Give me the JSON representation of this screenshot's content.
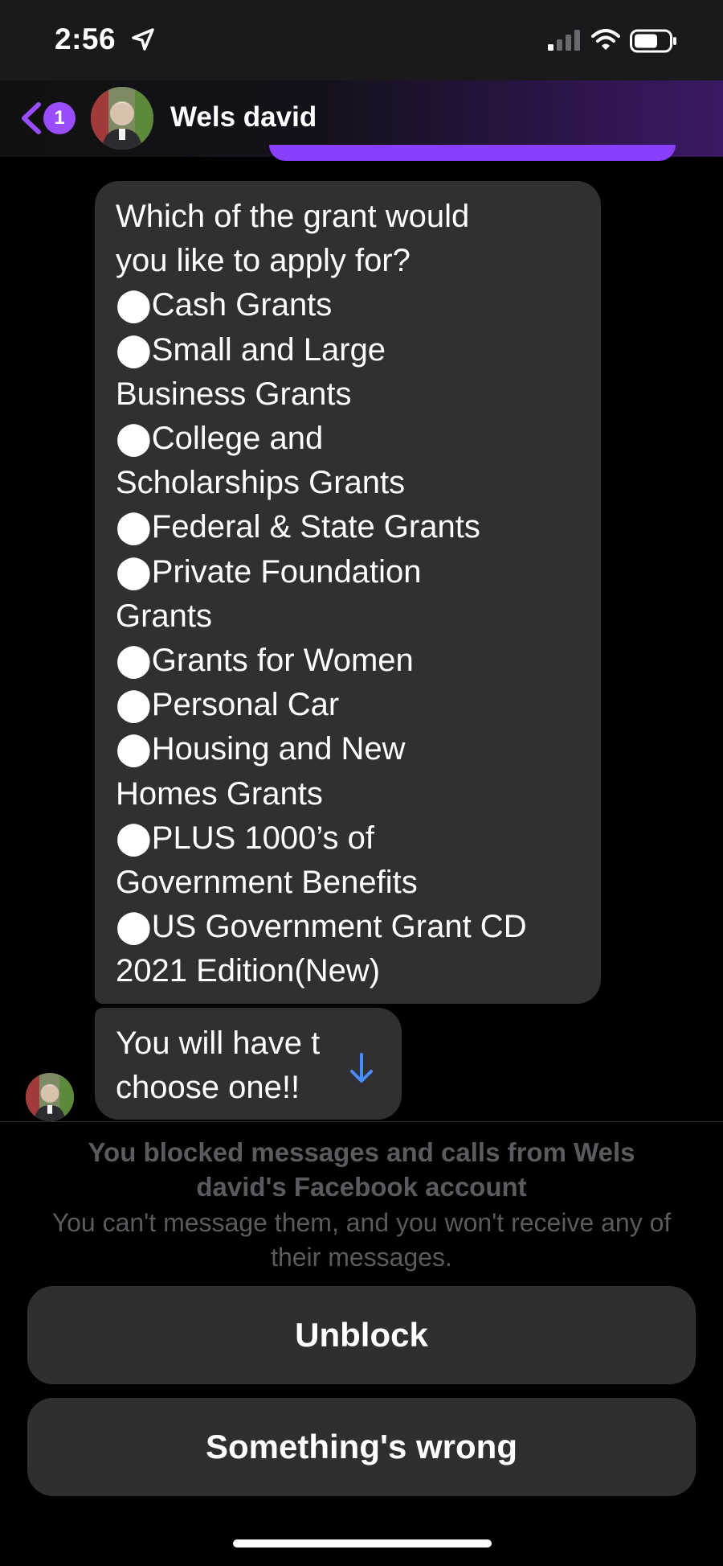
{
  "status_bar": {
    "time": "2:56",
    "icons": [
      "location-arrow-icon",
      "cellular-signal-icon",
      "wifi-icon",
      "battery-icon"
    ]
  },
  "header": {
    "back_badge_count": "1",
    "contact_name": "Wels david",
    "accent_color": "#9a4dff"
  },
  "messages": [
    {
      "sender": "Wels david",
      "lines": [
        "Which of the grant would",
        "you like to apply for?",
        "⬤Cash Grants",
        "⬤Small and Large",
        "Business Grants",
        "⬤College and",
        "Scholarships Grants",
        "⬤Federal & State Grants",
        "⬤Private Foundation",
        "Grants",
        "⬤Grants for Women",
        "⬤Personal Car",
        "⬤Housing and New",
        "Homes Grants",
        "⬤PLUS 1000’s of",
        "Government Benefits",
        "⬤US Government Grant CD",
        "2021 Edition(New)"
      ]
    },
    {
      "sender": "Wels david",
      "lines": [
        "You will have t",
        "choose one!!"
      ]
    }
  ],
  "blocked_notice": {
    "title": "You blocked messages and calls from Wels david's Facebook account",
    "description": "You can't message them, and you won't receive any of their messages."
  },
  "buttons": {
    "unblock": "Unblock",
    "something_wrong": "Something's wrong"
  },
  "colors": {
    "bubble": "#303032",
    "muted_text": "#5b5b5f",
    "scroll_arrow": "#4a8cff"
  }
}
